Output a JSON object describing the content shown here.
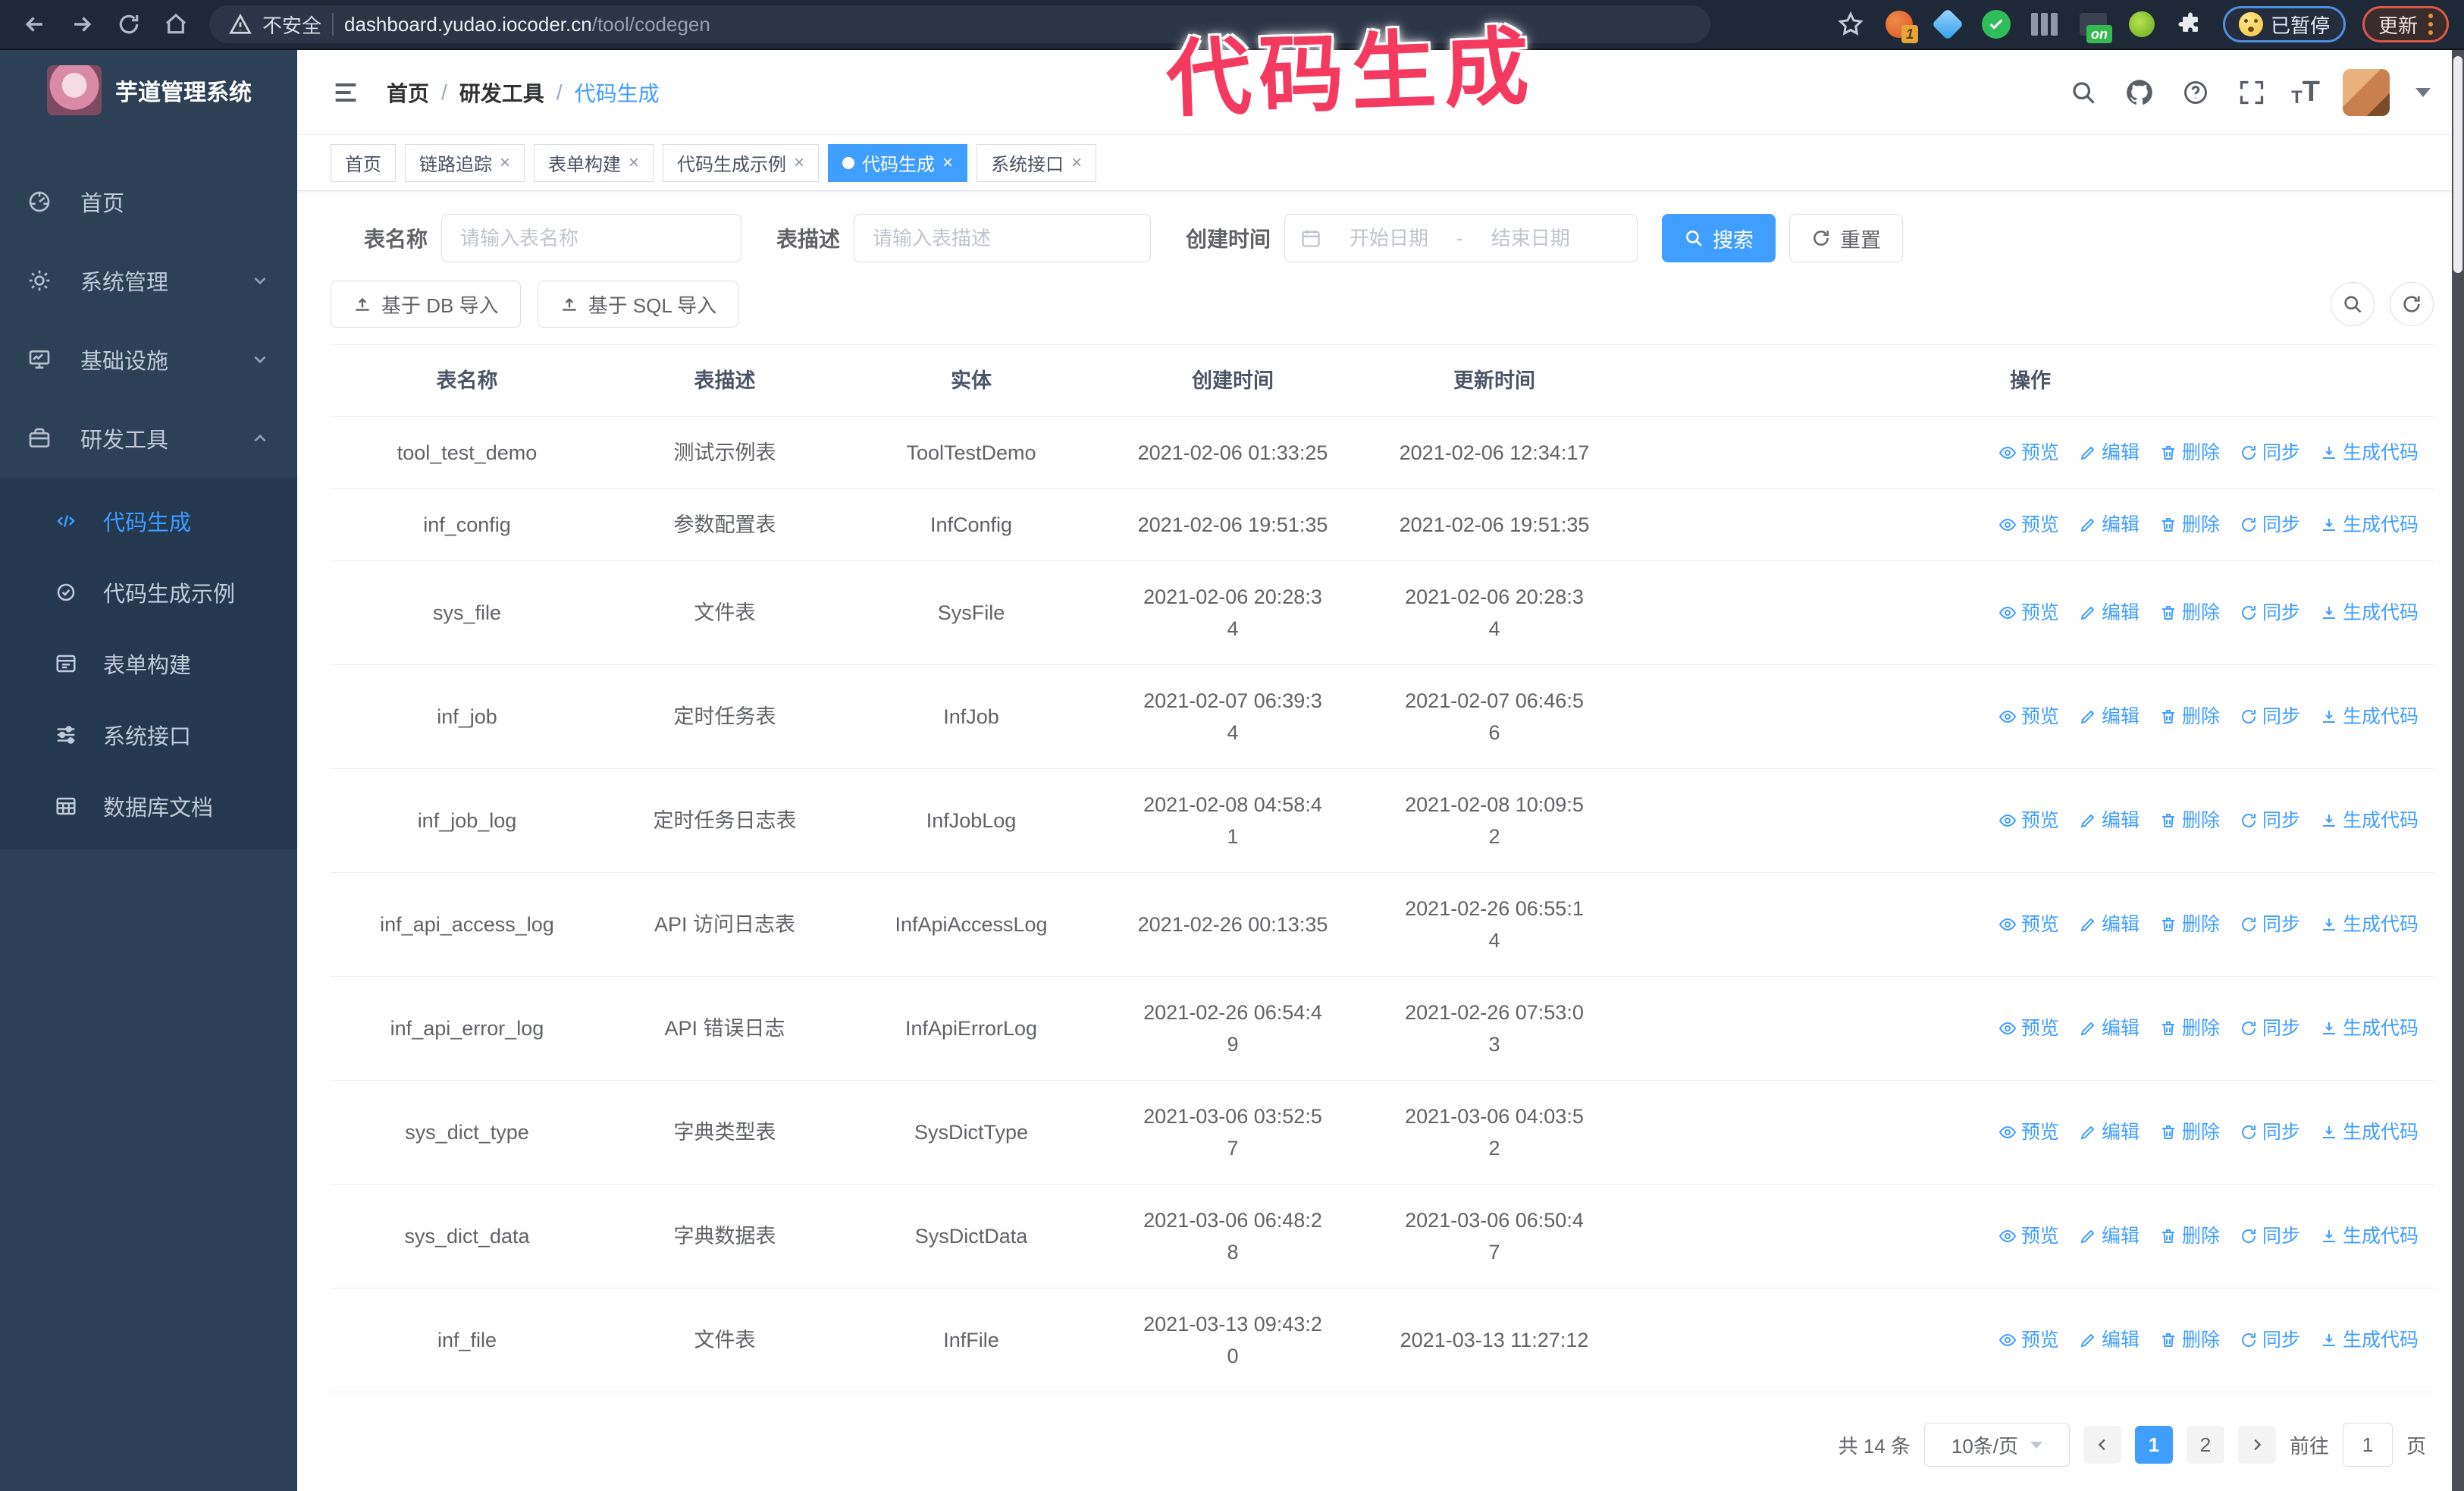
{
  "colors": {
    "accent": "#409eff",
    "annotation_pink": "#f43b5f",
    "chrome_bg": "#1f2836",
    "sidebar_bg": "#2d4156",
    "submenu_bg": "#243950",
    "tag_active": "#409eff"
  },
  "browser": {
    "security_label": "不安全",
    "url_host": "dashboard.yudao.iocoder.cn",
    "url_path": "/tool/codegen",
    "extension_badge": "1",
    "extension_on_badge": "on",
    "paused_label": "已暂停",
    "update_label": "更新"
  },
  "annotation": {
    "text": "代码生成"
  },
  "sidebar": {
    "title": "芋道管理系统",
    "items": [
      {
        "label": "首页"
      },
      {
        "label": "系统管理"
      },
      {
        "label": "基础设施"
      },
      {
        "label": "研发工具"
      }
    ],
    "submenu": [
      {
        "label": "代码生成"
      },
      {
        "label": "代码生成示例"
      },
      {
        "label": "表单构建"
      },
      {
        "label": "系统接口"
      },
      {
        "label": "数据库文档"
      }
    ]
  },
  "breadcrumb": {
    "items": [
      "首页",
      "研发工具",
      "代码生成"
    ],
    "separator": "/"
  },
  "tabs": {
    "close_glyph": "×",
    "items": [
      {
        "label": "首页"
      },
      {
        "label": "链路追踪"
      },
      {
        "label": "表单构建"
      },
      {
        "label": "代码生成示例"
      },
      {
        "label": "代码生成"
      },
      {
        "label": "系统接口"
      }
    ]
  },
  "filters": {
    "name_label": "表名称",
    "name_placeholder": "请输入表名称",
    "desc_label": "表描述",
    "desc_placeholder": "请输入表描述",
    "time_label": "创建时间",
    "start_placeholder": "开始日期",
    "range_separator": "-",
    "end_placeholder": "结束日期",
    "search_label": "搜索",
    "reset_label": "重置"
  },
  "toolbar": {
    "import_db_label": "基于 DB 导入",
    "import_sql_label": "基于 SQL 导入"
  },
  "table": {
    "columns": [
      "表名称",
      "表描述",
      "实体",
      "创建时间",
      "更新时间",
      "操作"
    ],
    "actions": [
      "预览",
      "编辑",
      "删除",
      "同步",
      "生成代码"
    ],
    "rows": [
      {
        "name": "tool_test_demo",
        "desc": "测试示例表",
        "entity": "ToolTestDemo",
        "created": "2021-02-06 01:33:25",
        "updated": "2021-02-06 12:34:17"
      },
      {
        "name": "inf_config",
        "desc": "参数配置表",
        "entity": "InfConfig",
        "created": "2021-02-06 19:51:35",
        "updated": "2021-02-06 19:51:35"
      },
      {
        "name": "sys_file",
        "desc": "文件表",
        "entity": "SysFile",
        "created": "2021-02-06 20:28:3\n4",
        "updated": "2021-02-06 20:28:3\n4"
      },
      {
        "name": "inf_job",
        "desc": "定时任务表",
        "entity": "InfJob",
        "created": "2021-02-07 06:39:3\n4",
        "updated": "2021-02-07 06:46:5\n6"
      },
      {
        "name": "inf_job_log",
        "desc": "定时任务日志表",
        "entity": "InfJobLog",
        "created": "2021-02-08 04:58:4\n1",
        "updated": "2021-02-08 10:09:5\n2"
      },
      {
        "name": "inf_api_access_log",
        "desc": "API 访问日志表",
        "entity": "InfApiAccessLog",
        "created": "2021-02-26 00:13:35",
        "updated": "2021-02-26 06:55:1\n4"
      },
      {
        "name": "inf_api_error_log",
        "desc": "API 错误日志",
        "entity": "InfApiErrorLog",
        "created": "2021-02-26 06:54:4\n9",
        "updated": "2021-02-26 07:53:0\n3"
      },
      {
        "name": "sys_dict_type",
        "desc": "字典类型表",
        "entity": "SysDictType",
        "created": "2021-03-06 03:52:5\n7",
        "updated": "2021-03-06 04:03:5\n2"
      },
      {
        "name": "sys_dict_data",
        "desc": "字典数据表",
        "entity": "SysDictData",
        "created": "2021-03-06 06:48:2\n8",
        "updated": "2021-03-06 06:50:4\n7"
      },
      {
        "name": "inf_file",
        "desc": "文件表",
        "entity": "InfFile",
        "created": "2021-03-13 09:43:2\n0",
        "updated": "2021-03-13 11:27:12"
      }
    ]
  },
  "pagination": {
    "total": "共 14 条",
    "page_size": "10条/页",
    "page_1": "1",
    "page_2": "2",
    "goto_label": "前往",
    "goto_value": "1",
    "goto_suffix": "页"
  },
  "glyphs": {
    "question_mark": "?",
    "t_small": "T",
    "t_large": "T"
  }
}
